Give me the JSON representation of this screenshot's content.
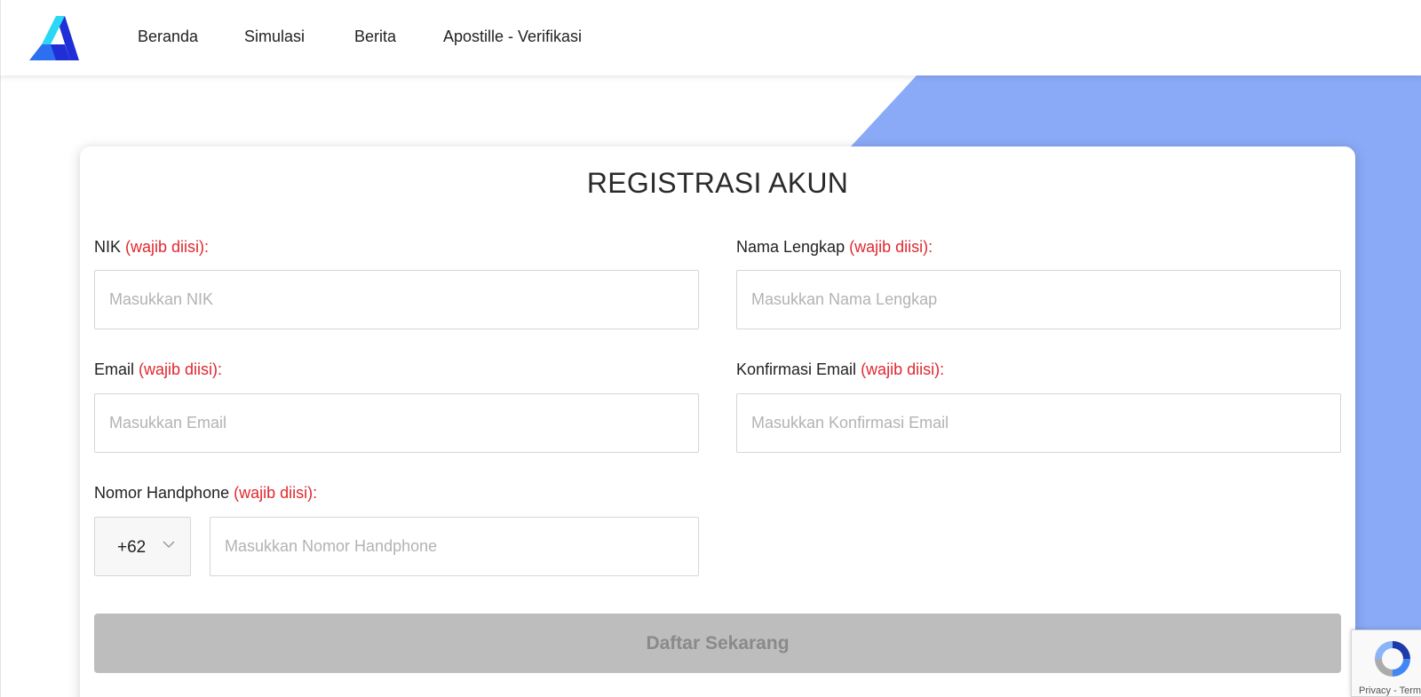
{
  "nav": {
    "logo": "brand-logo",
    "links": [
      "Beranda",
      "Simulasi",
      "Berita",
      "Apostille - Verifikasi"
    ]
  },
  "colors": {
    "accent_shape": "#8aaaf7",
    "required_text": "#e0282f",
    "button_disabled": "#bdbdbd",
    "logo_dark": "#1f2ed6",
    "logo_light": "#29d8f5"
  },
  "form": {
    "title": "REGISTRASI AKUN",
    "required_note": "(wajib diisi):",
    "nik": {
      "label": "NIK",
      "placeholder": "Masukkan NIK",
      "value": ""
    },
    "full_name": {
      "label": "Nama Lengkap",
      "placeholder": "Masukkan Nama Lengkap",
      "value": ""
    },
    "email": {
      "label": "Email",
      "placeholder": "Masukkan Email",
      "value": ""
    },
    "email_confirm": {
      "label": "Konfirmasi Email",
      "placeholder": "Masukkan Konfirmasi Email",
      "value": ""
    },
    "phone": {
      "label": "Nomor Handphone",
      "country_code": "+62",
      "placeholder": "Masukkan Nomor Handphone",
      "value": ""
    },
    "submit_label": "Daftar Sekarang",
    "submit_state": "disabled"
  },
  "recaptcha": {
    "links": "Privacy - Terms",
    "icon": "recaptcha-icon"
  }
}
